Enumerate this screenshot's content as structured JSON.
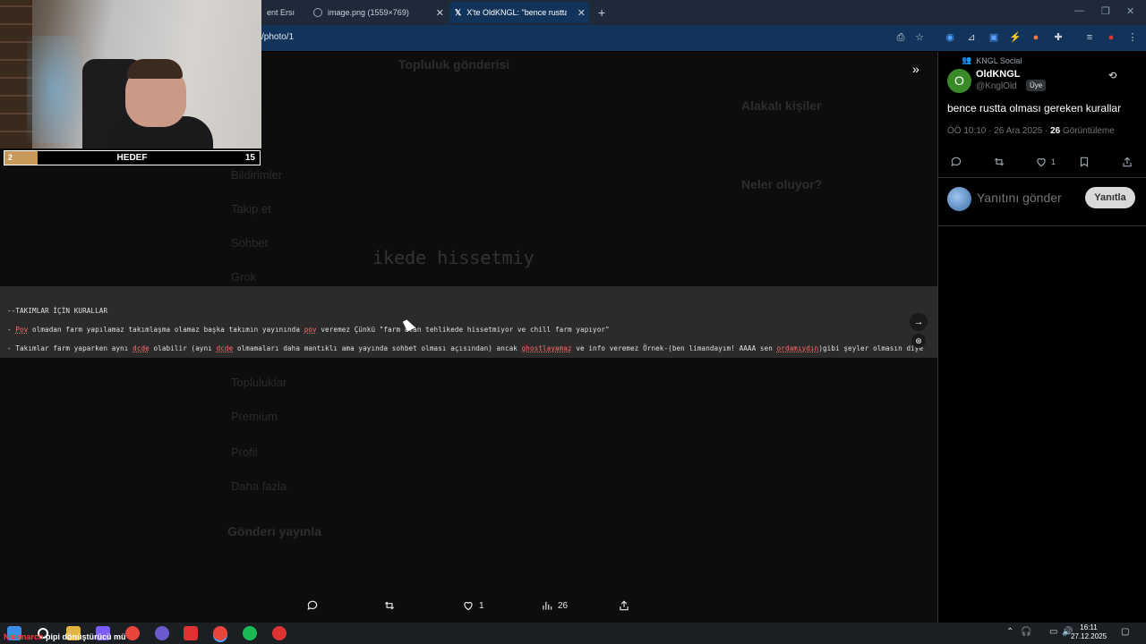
{
  "browser": {
    "tabs": [
      {
        "title": "ent Ersı"
      },
      {
        "title": "image.png (1559×769)"
      },
      {
        "title": "X'te OldKNGL: \"bence rustta olı"
      }
    ],
    "url": "/photo/1",
    "new_tab": "+"
  },
  "background_page": {
    "header": "Topluluk gönderisi",
    "related_people": "Alakalı kişiler",
    "whats_happening": "Neler oluyor?",
    "nav": [
      "Bildirimler",
      "Takip et",
      "Sohbet",
      "Grok",
      "Topluluklar",
      "Premium",
      "Profil",
      "Daha fazla"
    ],
    "post_button": "Gönderi yayınla"
  },
  "image_viewer": {
    "line1": "--TAKIMLAR İÇİN KURALLAR",
    "line2_pre": "- ",
    "line2_pov": "Pov",
    "line2_mid": " olmadan farm yapılamaz takımlaşma olamaz başka takımın yayınında ",
    "line2_pov2": "pov",
    "line2_end": " veremez Çünkü \"farm atan tehlikede hissetmiyor ve chill farm yapıyor\"",
    "line3_pre": "- Takımlar farm yaparken aynı ",
    "line3_d1": "dcde",
    "line3_mid": " olabilir (aynı ",
    "line3_d2": "dcde",
    "line3_mid2": " olmamaları daha mantıklı ama yayında sohbet olması açısından) ancak ",
    "line3_ghost": "ghostlayamaz",
    "line3_mid3": " ve info veremez Örnek-(ben limandayım! AAAA sen ",
    "line3_orda": "ordamıydın",
    "line3_end": ")gibi şeyler olmasın diye",
    "bg_zoom_text": "ikede hissetmiy"
  },
  "actions": {
    "likes": "1",
    "views": "26"
  },
  "post": {
    "community": "KNGL Social",
    "avatar_letter": "O",
    "display_name": "OldKNGL",
    "handle": "@KnglOld",
    "role": "Üye",
    "text": "bence rustta olması gereken kurallar",
    "time": "ÖÖ 10:10 · 26 Ara 2025 · ",
    "views_count": "26",
    "views_label": " Görüntüleme",
    "likes": "1",
    "reply_placeholder": "Yanıtını gönder",
    "reply_button": "Yanıtla"
  },
  "stream_goal": {
    "current": "2",
    "label": "HEDEF",
    "target": "15",
    "progress": 0.13
  },
  "taskbar": {
    "ticker_channel": "Nmonarch",
    "ticker_text": " pipi dönüştürücü mü",
    "time": "16:11",
    "date": "27.12.2025"
  },
  "colors": {
    "accent": "#1d9bf0",
    "goal_fill": "#c79a5a",
    "link_red": "#ff6b6b"
  }
}
